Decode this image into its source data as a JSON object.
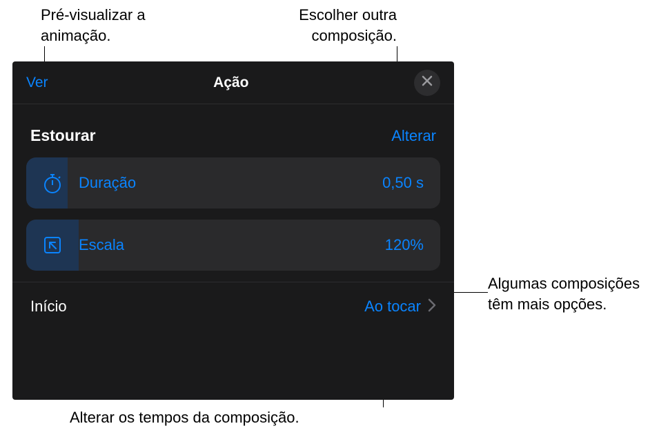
{
  "callouts": {
    "preview": "Pré-visualizar a animação.",
    "compose": "Escolher outra composição.",
    "options": "Algumas composições têm mais opções.",
    "timing": "Alterar os tempos da composição."
  },
  "panel": {
    "header": {
      "view_label": "Ver",
      "title": "Ação"
    },
    "effect": {
      "name": "Estourar",
      "change_label": "Alterar"
    },
    "options": {
      "duration": {
        "label": "Duração",
        "value": "0,50 s"
      },
      "scale": {
        "label": "Escala",
        "value": "120%"
      }
    },
    "start": {
      "label": "Início",
      "value": "Ao tocar"
    }
  }
}
